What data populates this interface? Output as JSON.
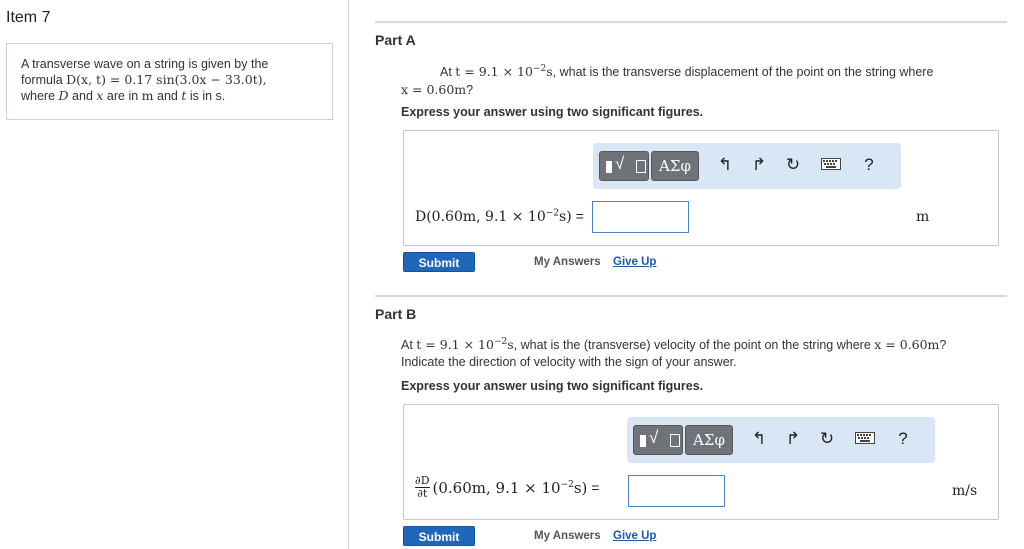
{
  "item_title": "Item 7",
  "problem": {
    "line1": "A transverse wave on a string is given by the",
    "line2_prefix": "formula ",
    "formula": "D(x, t) = 0.17 sin(3.0x − 33.0t),",
    "line3_where": "where ",
    "var_D": "D",
    "and_text": " and ",
    "var_x": "x",
    "are_in": " are in ",
    "unit_m": "m",
    "and_text2": " and ",
    "var_t": "t",
    "is_in_s": " is in s."
  },
  "part_a": {
    "title": "Part A",
    "q_at": "At ",
    "q_t_expr": "t = 9.1 × 10",
    "q_exp": "−2",
    "q_s": "s",
    "q_rest": ", what is the transverse displacement of the point on the string where",
    "q_x_expr": "x = 0.60m",
    "q_end": "?",
    "instruction": "Express your answer using two significant figures.",
    "toolbar": {
      "greek": "ΑΣφ",
      "help": "?"
    },
    "lhs_main": "D(0.60m, 9.1 × 10",
    "lhs_exp": "−2",
    "lhs_close": "s)",
    "lhs_eq": " =",
    "input_value": "",
    "unit": "m",
    "submit": "Submit",
    "my_answers": "My Answers",
    "give_up": "Give Up"
  },
  "part_b": {
    "title": "Part B",
    "q_at": "At ",
    "q_t_expr": "t = 9.1 × 10",
    "q_exp": "−2",
    "q_s": "s",
    "q_rest": ", what is the (transverse) velocity of the point on the string where ",
    "q_x_expr": "x = 0.60m",
    "q_end": "?",
    "q_line2": "Indicate the direction of velocity with the sign of your answer.",
    "instruction": "Express your answer using two significant figures.",
    "toolbar": {
      "greek": "ΑΣφ",
      "help": "?"
    },
    "lhs_num": "∂D",
    "lhs_den": "∂t",
    "lhs_main": "(0.60m, 9.1 × 10",
    "lhs_exp": "−2",
    "lhs_close": "s)",
    "lhs_eq": " =",
    "input_value": "",
    "unit": "m/s",
    "submit": "Submit",
    "my_answers": "My Answers",
    "give_up": "Give Up"
  },
  "icons": [
    "templates-icon",
    "greek-icon",
    "undo-icon",
    "redo-icon",
    "reset-icon",
    "keyboard-icon",
    "help-icon"
  ]
}
